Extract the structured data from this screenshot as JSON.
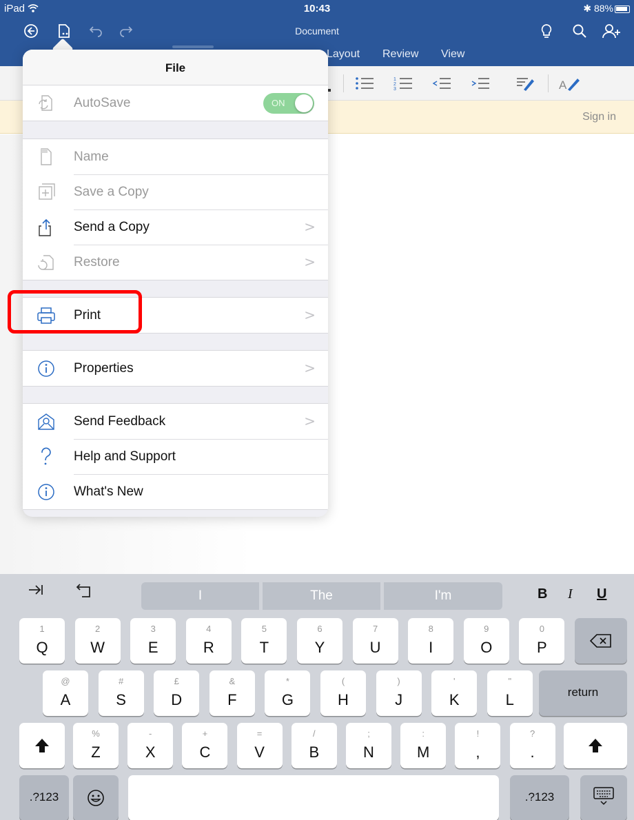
{
  "status": {
    "carrier": "iPad",
    "time": "10:43",
    "battery": "88%"
  },
  "app": {
    "document_title": "Document"
  },
  "tabs": [
    "Layout",
    "Review",
    "View"
  ],
  "signin": "Sign in",
  "popover": {
    "title": "File",
    "autosave": {
      "label": "AutoSave",
      "state": "ON"
    },
    "group2": [
      {
        "label": "Name",
        "icon": "document-icon",
        "enabled": false,
        "chevron": false
      },
      {
        "label": "Save a Copy",
        "icon": "save-copy-icon",
        "enabled": false,
        "chevron": false
      },
      {
        "label": "Send a Copy",
        "icon": "share-icon",
        "enabled": true,
        "chevron": true
      },
      {
        "label": "Restore",
        "icon": "restore-icon",
        "enabled": false,
        "chevron": true
      }
    ],
    "print": {
      "label": "Print",
      "icon": "printer-icon"
    },
    "properties": {
      "label": "Properties",
      "icon": "info-icon"
    },
    "group5": [
      {
        "label": "Send Feedback",
        "icon": "feedback-icon",
        "chevron": true
      },
      {
        "label": "Help and Support",
        "icon": "help-icon",
        "chevron": false
      },
      {
        "label": "What's New",
        "icon": "info-icon",
        "chevron": false
      }
    ],
    "chevron_glyph": ">"
  },
  "keyboard": {
    "suggestions": [
      "I",
      "The",
      "I'm"
    ],
    "format": {
      "bold": "B",
      "italic": "I",
      "underline": "U"
    },
    "row1": [
      {
        "main": "Q",
        "sub": "1"
      },
      {
        "main": "W",
        "sub": "2"
      },
      {
        "main": "E",
        "sub": "3"
      },
      {
        "main": "R",
        "sub": "4"
      },
      {
        "main": "T",
        "sub": "5"
      },
      {
        "main": "Y",
        "sub": "6"
      },
      {
        "main": "U",
        "sub": "7"
      },
      {
        "main": "I",
        "sub": "8"
      },
      {
        "main": "O",
        "sub": "9"
      },
      {
        "main": "P",
        "sub": "0"
      }
    ],
    "row2": [
      {
        "main": "A",
        "sub": "@"
      },
      {
        "main": "S",
        "sub": "#"
      },
      {
        "main": "D",
        "sub": "£"
      },
      {
        "main": "F",
        "sub": "&"
      },
      {
        "main": "G",
        "sub": "*"
      },
      {
        "main": "H",
        "sub": "("
      },
      {
        "main": "J",
        "sub": ")"
      },
      {
        "main": "K",
        "sub": "'"
      },
      {
        "main": "L",
        "sub": "\""
      }
    ],
    "row3": [
      {
        "main": "Z",
        "sub": "%"
      },
      {
        "main": "X",
        "sub": "-"
      },
      {
        "main": "C",
        "sub": "+"
      },
      {
        "main": "V",
        "sub": "="
      },
      {
        "main": "B",
        "sub": "/"
      },
      {
        "main": "N",
        "sub": ";"
      },
      {
        "main": "M",
        "sub": ":"
      },
      {
        "main": ",",
        "sub": "!"
      },
      {
        "main": ".",
        "sub": "?"
      }
    ],
    "return_label": "return",
    "numbers_label": ".?123"
  }
}
